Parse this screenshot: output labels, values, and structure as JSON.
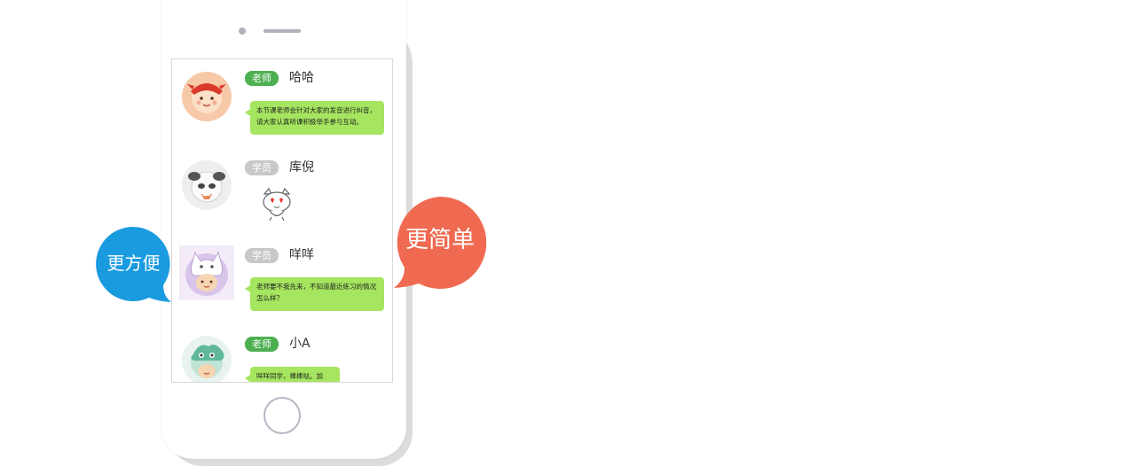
{
  "callouts": {
    "left": {
      "text": "更方便",
      "color": "#1a9be0"
    },
    "right": {
      "text": "更简单",
      "color": "#f06a52"
    }
  },
  "colors": {
    "teacher_badge": "#4caf50",
    "student_badge": "#c8c8c8",
    "bubble": "#a5e55f"
  },
  "chat": {
    "messages": [
      {
        "role": "老师",
        "name": "哈哈",
        "avatar": "red-dog-avatar",
        "text": "本节课老师会针对大家的发音进行纠音，请大家认真听课积极举手参与互动。"
      },
      {
        "role": "学员",
        "name": "库倪",
        "avatar": "panda-avatar",
        "sticker": "heart-eyes-cat-sticker"
      },
      {
        "role": "学员",
        "name": "咩咩",
        "avatar": "white-cat-hat-avatar",
        "text": "老师要不我先来，不知道最近练习的情况怎么样？"
      },
      {
        "role": "老师",
        "name": "小A",
        "avatar": "green-dino-avatar",
        "text": "咩咩同学，棒棒哒。加油！"
      }
    ]
  }
}
